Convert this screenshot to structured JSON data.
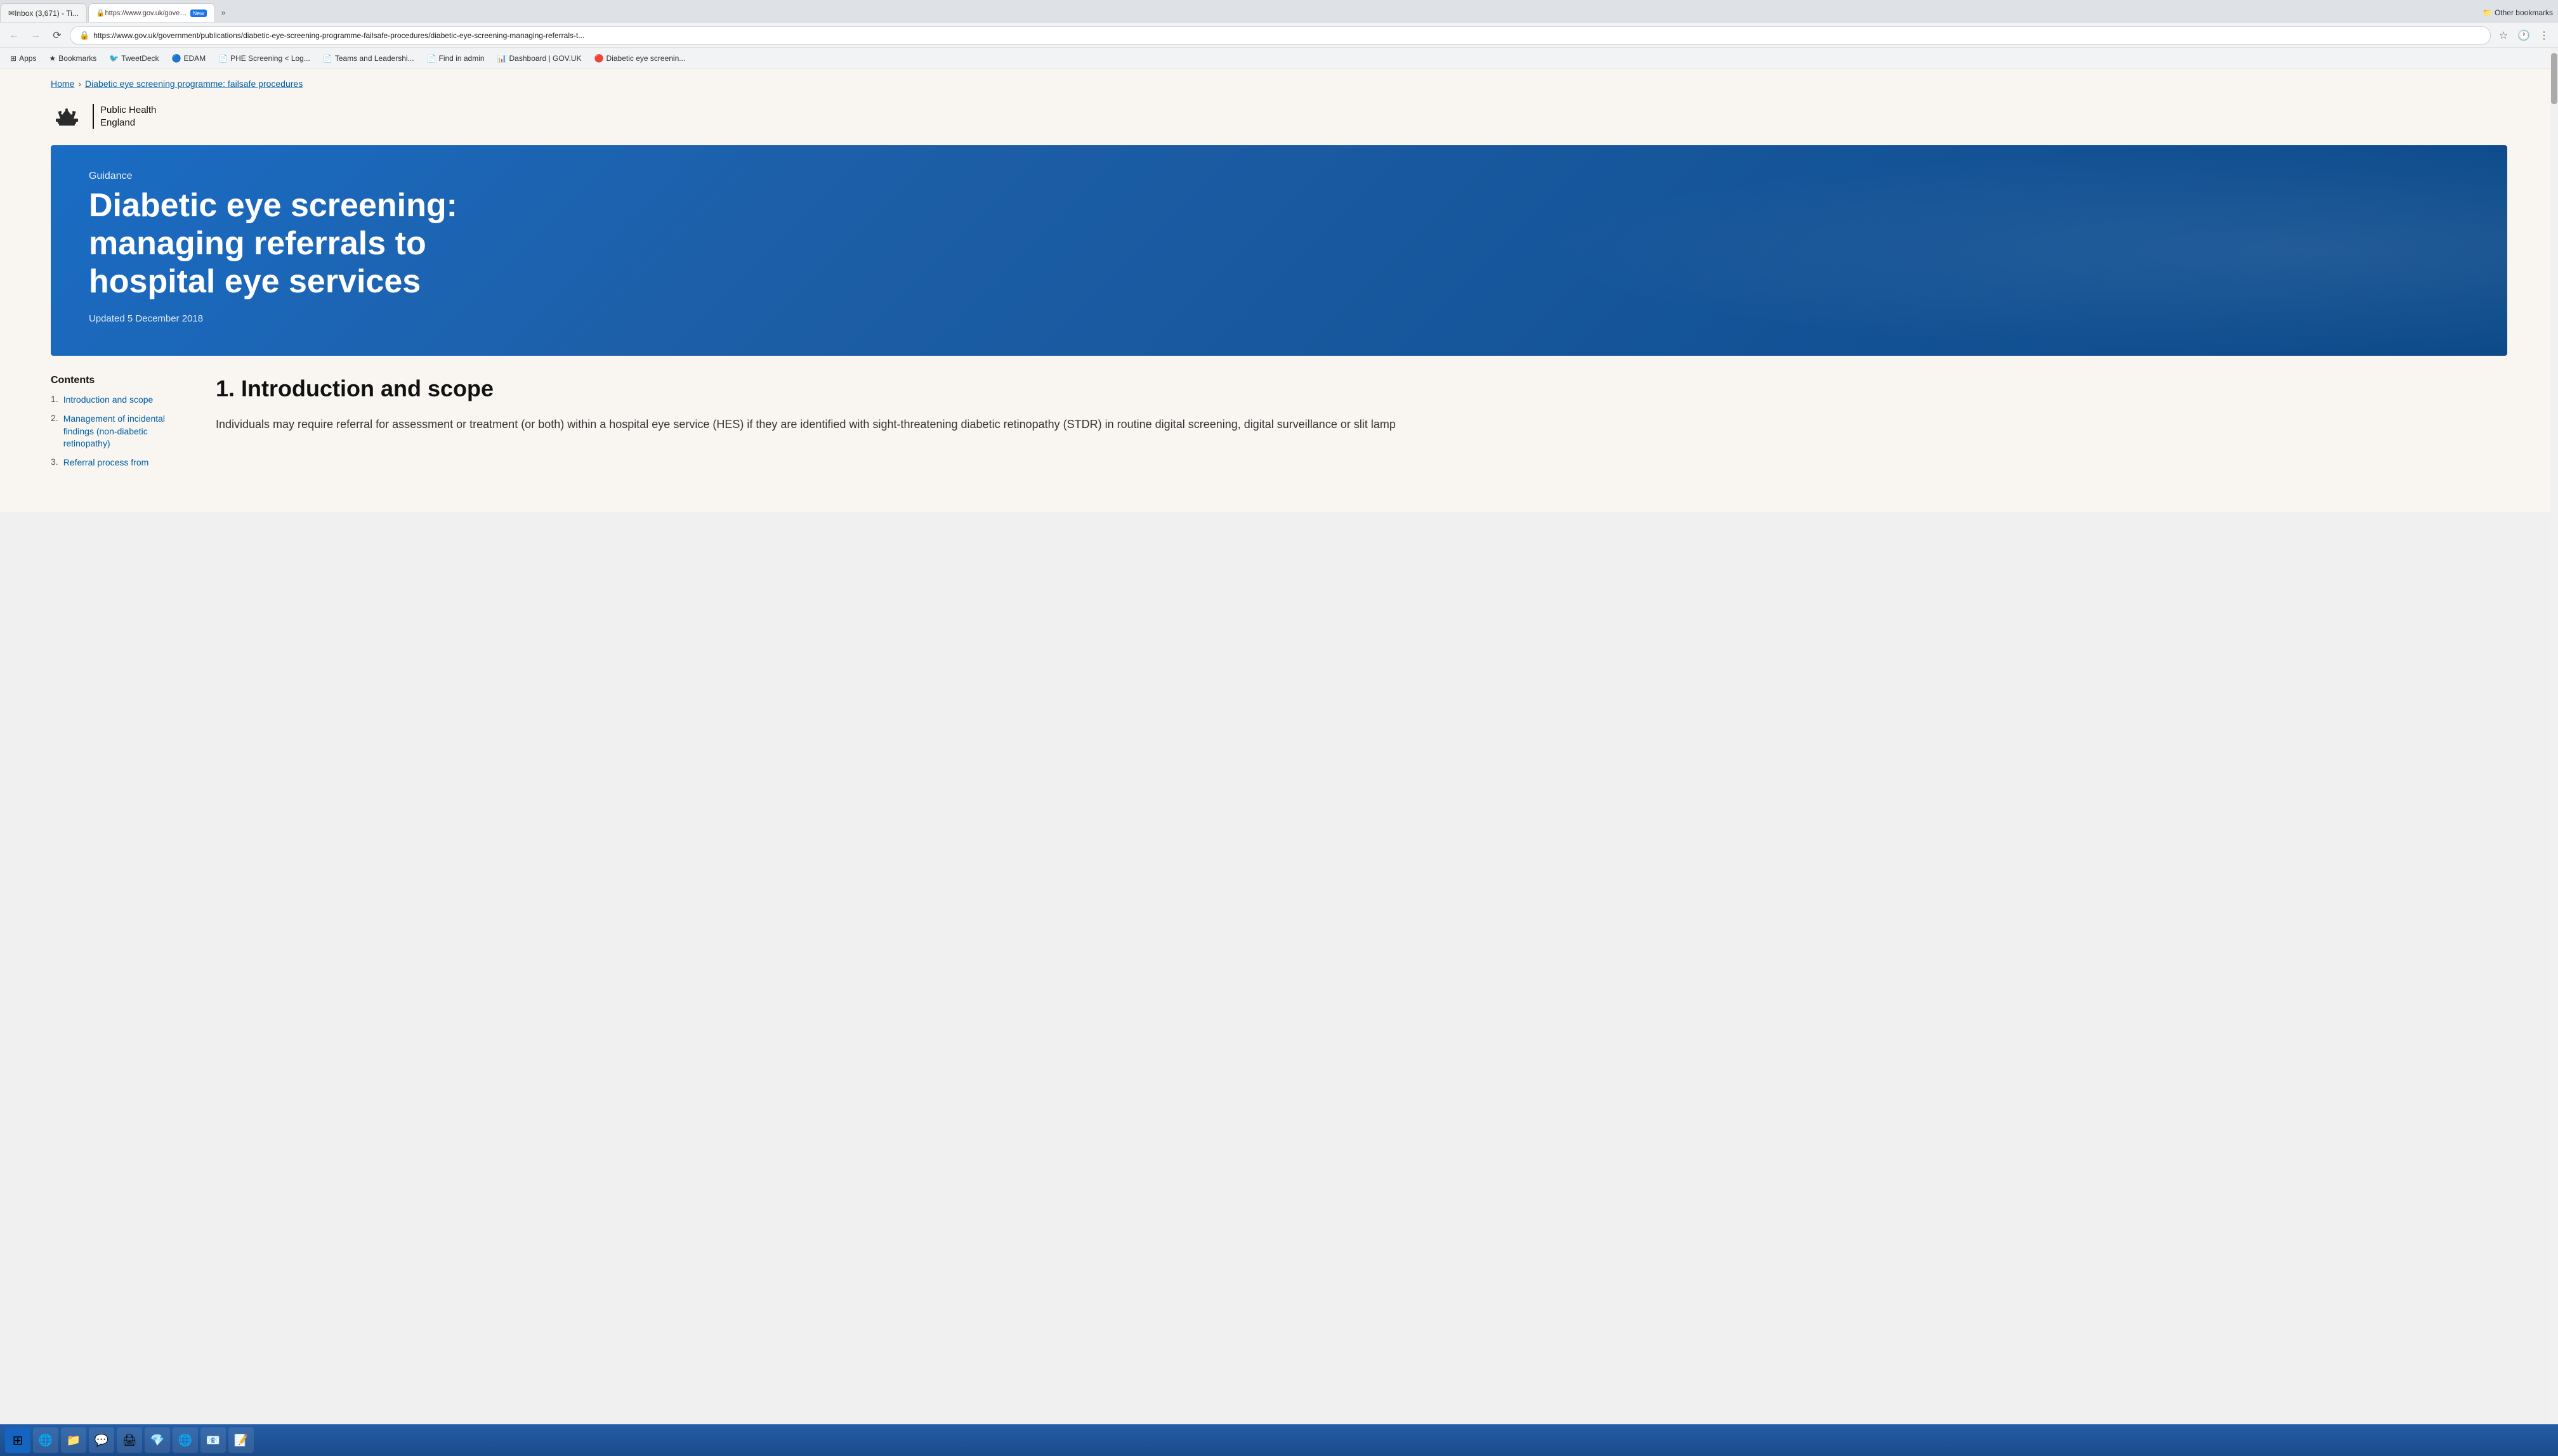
{
  "browser": {
    "tabs": [
      {
        "id": "tab1",
        "label": "Inbox (3,671) - Ti...",
        "active": false,
        "favicon": "✉"
      },
      {
        "id": "tab2",
        "label": "",
        "active": true,
        "favicon": "🔒",
        "new_badge": "New"
      }
    ],
    "url": "https://www.gov.uk/government/publications/diabetic-eye-screening-programme-failsafe-procedures/diabetic-eye-screening-managing-referrals-t...",
    "tab_more_label": "»",
    "back_disabled": false,
    "forward_disabled": true
  },
  "bookmarks": {
    "bar": [
      {
        "label": "Apps",
        "icon": "⊞",
        "type": "apps"
      },
      {
        "label": "Bookmarks",
        "icon": "★",
        "type": "folder"
      },
      {
        "label": "TweetDeck",
        "icon": "🐦",
        "type": "link"
      },
      {
        "label": "EDAM",
        "icon": "🔵",
        "type": "link"
      },
      {
        "label": "PHE Screening < Log...",
        "icon": "📄",
        "type": "link"
      },
      {
        "label": "Teams and Leadershi...",
        "icon": "📄",
        "type": "link"
      },
      {
        "label": "Find in admin",
        "icon": "📄",
        "type": "link"
      },
      {
        "label": "Dashboard | GOV.UK",
        "icon": "📊",
        "type": "link"
      },
      {
        "label": "Diabetic eye screenin...",
        "icon": "🔴",
        "type": "link"
      }
    ],
    "other_label": "Other bookmarks",
    "other_icon": "📁"
  },
  "page": {
    "breadcrumb": {
      "home": "Home",
      "parent": "Diabetic eye screening programme: failsafe procedures"
    },
    "phe_logo": {
      "org_name_line1": "Public Health",
      "org_name_line2": "England"
    },
    "hero": {
      "guidance_label": "Guidance",
      "title": "Diabetic eye screening: managing referrals to hospital eye services",
      "updated_text": "Updated 5 December 2018",
      "bg_color": "#1565c0"
    },
    "contents": {
      "title": "Contents",
      "items": [
        {
          "num": "1.",
          "label": "Introduction and scope"
        },
        {
          "num": "2.",
          "label": "Management of incidental findings (non-diabetic retinopathy)"
        },
        {
          "num": "3.",
          "label": "Referral process from"
        }
      ]
    },
    "section1": {
      "title": "1. Introduction and scope",
      "body": "Individuals may require referral for assessment or treatment (or both) within a hospital eye service (HES) if they are identified with sight-threatening diabetic retinopathy (STDR) in routine digital screening, digital surveillance or slit lamp"
    }
  },
  "taskbar": {
    "start_label": "⊞",
    "items": [
      {
        "label": "🌐",
        "name": "ie-icon"
      },
      {
        "label": "📁",
        "name": "files-icon"
      },
      {
        "label": "💬",
        "name": "skype-icon"
      },
      {
        "label": "🖨",
        "name": "print-icon"
      },
      {
        "label": "💎",
        "name": "diamond-icon"
      },
      {
        "label": "🌐",
        "name": "chrome-icon"
      },
      {
        "label": "📧",
        "name": "outlook-icon"
      },
      {
        "label": "📝",
        "name": "word-icon"
      }
    ]
  }
}
